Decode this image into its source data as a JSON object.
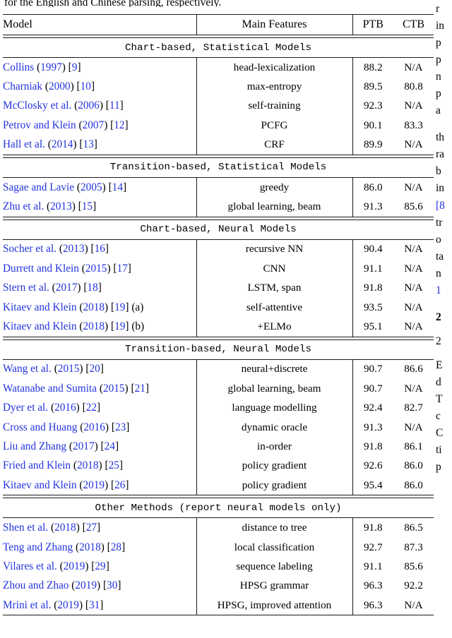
{
  "page": {
    "caption_tail": "for the English and Chinese parsing, respectively."
  },
  "table": {
    "headers": {
      "model": "Model",
      "features": "Main Features",
      "ptb": "PTB",
      "ctb": "CTB"
    },
    "sections": [
      {
        "title": "Chart-based, Statistical Models",
        "rows": [
          {
            "author": "Collins",
            "year": "(1997)",
            "ref": "[9]",
            "suffix": "",
            "features": "head-lexicalization",
            "ptb": "88.2",
            "ptb_bold": false,
            "ctb": "N/A",
            "ctb_bold": false
          },
          {
            "author": "Charniak",
            "year": "(2000)",
            "ref": "[10]",
            "suffix": "",
            "features": "max-entropy",
            "ptb": "89.5",
            "ptb_bold": false,
            "ctb": "80.8",
            "ctb_bold": false
          },
          {
            "author": "McClosky et al.",
            "year": "(2006)",
            "ref": "[11]",
            "suffix": "",
            "features": "self-training",
            "ptb": "92.3",
            "ptb_bold": true,
            "ctb": "N/A",
            "ctb_bold": false
          },
          {
            "author": "Petrov and Klein",
            "year": "(2007)",
            "ref": "[12]",
            "suffix": "",
            "features": "PCFG",
            "ptb": "90.1",
            "ptb_bold": false,
            "ctb": "83.3",
            "ctb_bold": true
          },
          {
            "author": "Hall et al.",
            "year": "(2014)",
            "ref": "[13]",
            "suffix": "",
            "features": "CRF",
            "ptb": "89.9",
            "ptb_bold": false,
            "ctb": "N/A",
            "ctb_bold": false
          }
        ]
      },
      {
        "title": "Transition-based, Statistical Models",
        "rows": [
          {
            "author": "Sagae and Lavie",
            "year": "(2005)",
            "ref": "[14]",
            "suffix": "",
            "features": "greedy",
            "ptb": "86.0",
            "ptb_bold": false,
            "ctb": "N/A",
            "ctb_bold": false
          },
          {
            "author": "Zhu et al.",
            "year": "(2013)",
            "ref": "[15]",
            "suffix": "",
            "features": "global learning, beam",
            "ptb": "91.3",
            "ptb_bold": true,
            "ctb": "85.6",
            "ctb_bold": true
          }
        ]
      },
      {
        "title": "Chart-based, Neural Models",
        "rows": [
          {
            "author": "Socher et al.",
            "year": "(2013)",
            "ref": "[16]",
            "suffix": "",
            "features": "recursive NN",
            "ptb": "90.4",
            "ptb_bold": false,
            "ctb": "N/A",
            "ctb_bold": false
          },
          {
            "author": "Durrett and Klein",
            "year": "(2015)",
            "ref": "[17]",
            "suffix": "",
            "features": "CNN",
            "ptb": "91.1",
            "ptb_bold": false,
            "ctb": "N/A",
            "ctb_bold": false
          },
          {
            "author": "Stern et al.",
            "year": "(2017)",
            "ref": "[18]",
            "suffix": "",
            "features": "LSTM, span",
            "ptb": "91.8",
            "ptb_bold": false,
            "ctb": "N/A",
            "ctb_bold": false
          },
          {
            "author": "Kitaev and Klein",
            "year": "(2018)",
            "ref": "[19]",
            "suffix": "(a)",
            "features": "self-attentive",
            "ptb": "93.5",
            "ptb_bold": false,
            "ctb": "N/A",
            "ctb_bold": false
          },
          {
            "author": "Kitaev and Klein",
            "year": "(2018)",
            "ref": "[19]",
            "suffix": "(b)",
            "features": "+ELMo",
            "ptb": "95.1",
            "ptb_bold": true,
            "ctb": "N/A",
            "ctb_bold": false
          }
        ]
      },
      {
        "title": "Transition-based, Neural Models",
        "rows": [
          {
            "author": "Wang et al.",
            "year": "(2015)",
            "ref": "[20]",
            "suffix": "",
            "features": "neural+discrete",
            "ptb": "90.7",
            "ptb_bold": false,
            "ctb": "86.6",
            "ctb_bold": true
          },
          {
            "author": "Watanabe and Sumita",
            "year": "(2015)",
            "ref": "[21]",
            "suffix": "",
            "features": "global learning, beam",
            "ptb": "90.7",
            "ptb_bold": false,
            "ctb": "N/A",
            "ctb_bold": false
          },
          {
            "author": "Dyer et al.",
            "year": "(2016)",
            "ref": "[22]",
            "suffix": "",
            "features": "language modelling",
            "ptb": "92.4",
            "ptb_bold": false,
            "ctb": "82.7",
            "ctb_bold": false
          },
          {
            "author": "Cross and Huang",
            "year": "(2016)",
            "ref": "[23]",
            "suffix": "",
            "features": "dynamic oracle",
            "ptb": "91.3",
            "ptb_bold": false,
            "ctb": "N/A",
            "ctb_bold": false
          },
          {
            "author": "Liu and Zhang",
            "year": "(2017)",
            "ref": "[24]",
            "suffix": "",
            "features": "in-order",
            "ptb": "91.8",
            "ptb_bold": false,
            "ctb": "86.1",
            "ctb_bold": false
          },
          {
            "author": "Fried and Klein",
            "year": "(2018)",
            "ref": "[25]",
            "suffix": "",
            "features": "policy gradient",
            "ptb": "92.6",
            "ptb_bold": false,
            "ctb": "86.0",
            "ctb_bold": false
          },
          {
            "author": "Kitaev and Klein",
            "year": "(2019)",
            "ref": "[26]",
            "suffix": "",
            "features": "policy gradient",
            "ptb": "95.4",
            "ptb_bold": true,
            "ctb": "86.0",
            "ctb_bold": false
          }
        ]
      },
      {
        "title": "Other Methods (report neural models only)",
        "rows": [
          {
            "author": "Shen et al.",
            "year": "(2018)",
            "ref": "[27]",
            "suffix": "",
            "features": "distance to tree",
            "ptb": "91.8",
            "ptb_bold": false,
            "ctb": "86.5",
            "ctb_bold": false
          },
          {
            "author": "Teng and Zhang",
            "year": "(2018)",
            "ref": "[28]",
            "suffix": "",
            "features": "local classification",
            "ptb": "92.7",
            "ptb_bold": false,
            "ctb": "87.3",
            "ctb_bold": false
          },
          {
            "author": "Vilares et al.",
            "year": "(2019)",
            "ref": "[29]",
            "suffix": "",
            "features": "sequence labeling",
            "ptb": "91.1",
            "ptb_bold": false,
            "ctb": "85.6",
            "ctb_bold": false
          },
          {
            "author": "Zhou and Zhao",
            "year": "(2019)",
            "ref": "[30]",
            "suffix": "",
            "features": "HPSG grammar",
            "ptb": "96.3",
            "ptb_bold": true,
            "ctb": "92.2",
            "ctb_bold": true
          },
          {
            "author": "Mrini et al.",
            "year": "(2019)",
            "ref": "[31]",
            "suffix": "",
            "features": "HPSG, improved attention",
            "ptb": "96.3",
            "ptb_bold": true,
            "ctb": "N/A",
            "ctb_bold": true
          }
        ]
      }
    ]
  },
  "right_column_fragments": [
    {
      "text": "r",
      "style": "plain"
    },
    {
      "text": "in",
      "style": "plain"
    },
    {
      "text": "p",
      "style": "plain"
    },
    {
      "text": "p",
      "style": "plain"
    },
    {
      "text": "n",
      "style": "plain"
    },
    {
      "text": "p",
      "style": "plain"
    },
    {
      "text": "a",
      "style": "plain"
    },
    {
      "text": "",
      "style": "gap"
    },
    {
      "text": "th",
      "style": "plain"
    },
    {
      "text": "ra",
      "style": "plain"
    },
    {
      "text": "b",
      "style": "plain"
    },
    {
      "text": "in",
      "style": "plain"
    },
    {
      "text": "[8",
      "style": "link"
    },
    {
      "text": "tr",
      "style": "plain"
    },
    {
      "text": "o",
      "style": "plain"
    },
    {
      "text": "ta",
      "style": "plain"
    },
    {
      "text": "n",
      "style": "plain"
    },
    {
      "text": "1",
      "style": "link"
    },
    {
      "text": "",
      "style": "gap"
    },
    {
      "text": "2",
      "style": "bold"
    },
    {
      "text": "",
      "style": "gap-s"
    },
    {
      "text": "2",
      "style": "plain"
    },
    {
      "text": "",
      "style": "gap-s"
    },
    {
      "text": "E",
      "style": "plain"
    },
    {
      "text": "d",
      "style": "plain"
    },
    {
      "text": "T",
      "style": "plain"
    },
    {
      "text": "c",
      "style": "plain"
    },
    {
      "text": "C",
      "style": "plain"
    },
    {
      "text": "ti",
      "style": "plain"
    },
    {
      "text": "p",
      "style": "plain"
    }
  ]
}
